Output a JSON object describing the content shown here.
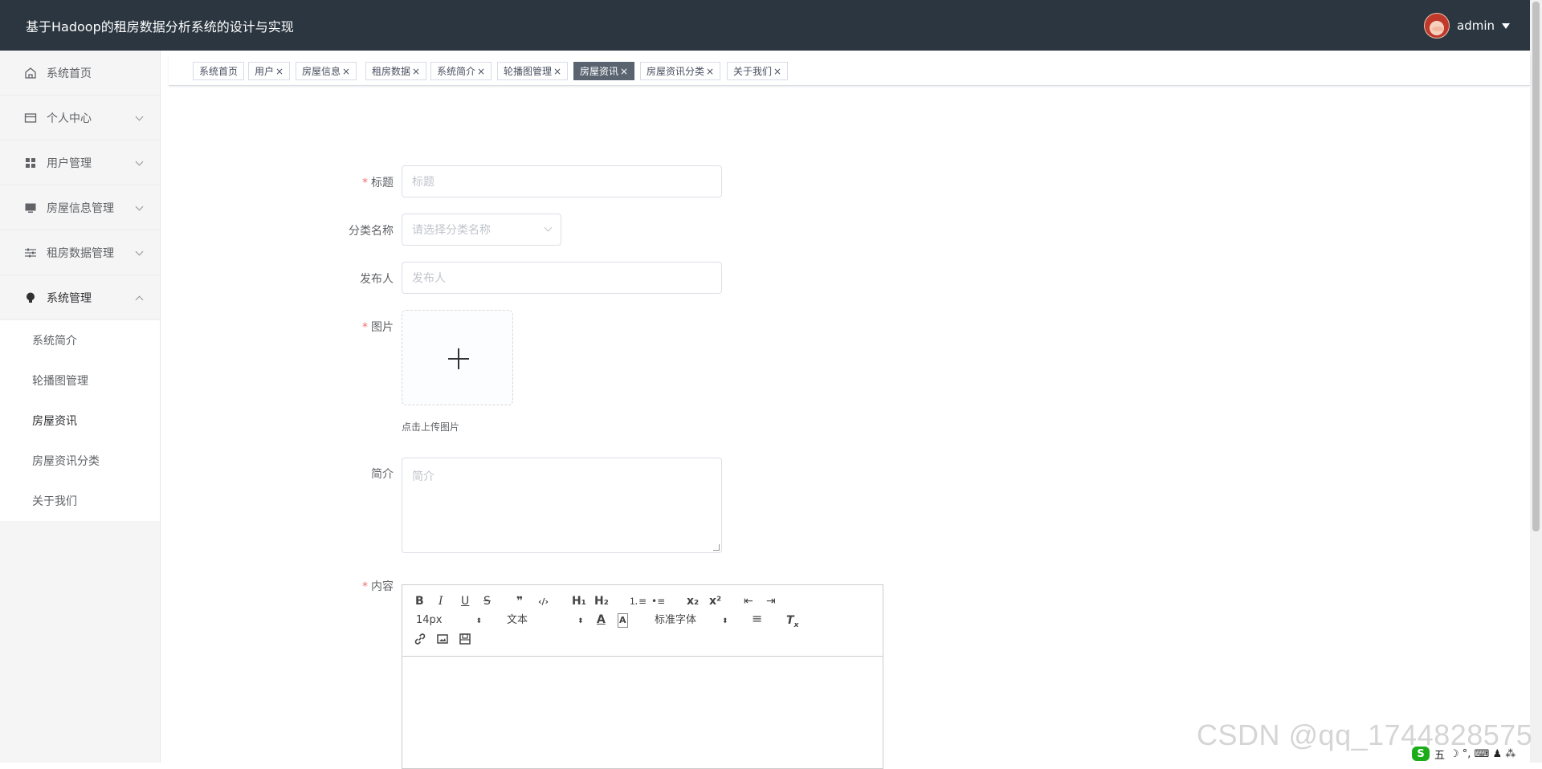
{
  "app": {
    "title": "基于Hadoop的租房数据分析系统的设计与实现",
    "username": "admin"
  },
  "sidebar": {
    "items": [
      {
        "label": "系统首页",
        "icon": "home-icon"
      },
      {
        "label": "个人中心",
        "icon": "card-icon"
      },
      {
        "label": "用户管理",
        "icon": "grid-icon"
      },
      {
        "label": "房屋信息管理",
        "icon": "monitor-icon"
      },
      {
        "label": "租房数据管理",
        "icon": "sliders-icon"
      },
      {
        "label": "系统管理",
        "icon": "bulb-icon"
      }
    ],
    "submenu": [
      {
        "label": "系统简介"
      },
      {
        "label": "轮播图管理"
      },
      {
        "label": "房屋资讯"
      },
      {
        "label": "房屋资讯分类"
      },
      {
        "label": "关于我们"
      }
    ]
  },
  "tabs": [
    {
      "label": "系统首页",
      "close": ""
    },
    {
      "label": "用户",
      "close": "×"
    },
    {
      "label": "房屋信息",
      "close": "×"
    },
    {
      "label": "租房数据",
      "close": "×"
    },
    {
      "label": "系统简介",
      "close": "×"
    },
    {
      "label": "轮播图管理",
      "close": "×"
    },
    {
      "label": "房屋资讯",
      "close": "×"
    },
    {
      "label": "房屋资讯分类",
      "close": "×"
    },
    {
      "label": "关于我们",
      "close": "×"
    }
  ],
  "form": {
    "required_mark": "*",
    "title_label": "标题",
    "title_placeholder": "标题",
    "category_label": "分类名称",
    "category_placeholder": "请选择分类名称",
    "publisher_label": "发布人",
    "publisher_placeholder": "发布人",
    "image_label": "图片",
    "upload_hint": "点击上传图片",
    "intro_label": "简介",
    "intro_placeholder": "简介",
    "content_label": "内容"
  },
  "editor": {
    "bold": "B",
    "italic": "I",
    "underline": "U",
    "strike": "S",
    "quote": "❞",
    "code": "‹/›",
    "h1": "H₁",
    "h2": "H₂",
    "ordered_list": "⒈≡",
    "bullet_list": "•≡",
    "sub": "x₂",
    "sup": "x²",
    "outdent": "⇤",
    "indent": "⇥",
    "size": "14px",
    "header": "文本",
    "font": "标准字体",
    "link": "🔗",
    "image": "▣",
    "video": "▤",
    "clean": "T̶ₓ"
  },
  "watermark": "CSDN @qq_1744828575",
  "tray": {
    "ime_logo": "S",
    "ime_mode": "五",
    "items": "☽ °, ⌨ ♟ ⁂"
  },
  "colors": {
    "header_bg": "#2b3640",
    "active_tab": "#5a6470",
    "required": "#f56c6c"
  }
}
